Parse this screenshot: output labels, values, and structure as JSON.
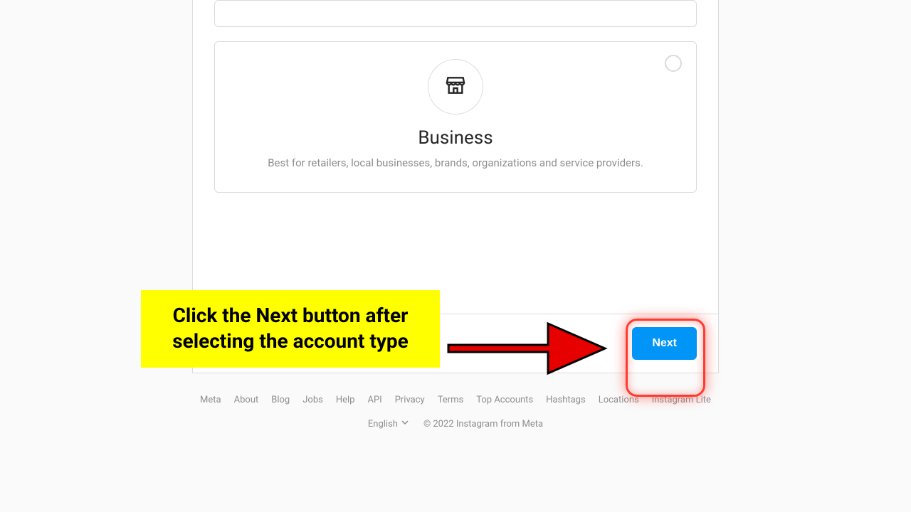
{
  "card": {
    "title": "Business",
    "description": "Best for retailers, local businesses, brands, organizations and service providers."
  },
  "action": {
    "next_label": "Next"
  },
  "footer": {
    "links": [
      "Meta",
      "About",
      "Blog",
      "Jobs",
      "Help",
      "API",
      "Privacy",
      "Terms",
      "Top Accounts",
      "Hashtags",
      "Locations",
      "Instagram Lite"
    ],
    "language": "English",
    "copyright": "© 2022 Instagram from Meta"
  },
  "annotation": {
    "callout_text": "Click the Next button after selecting the account type"
  }
}
